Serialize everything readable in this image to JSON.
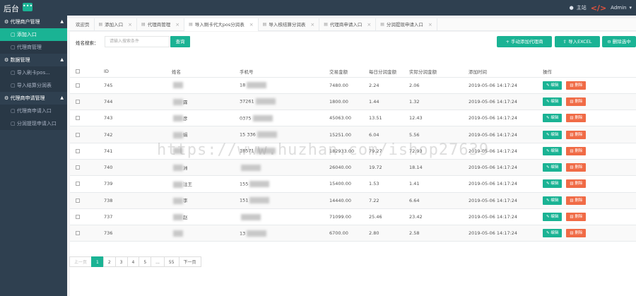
{
  "app": {
    "title": "后台",
    "menu_icon": "menu-dots-icon",
    "home_label": "主站",
    "admin_label": "Admin"
  },
  "sidebar": {
    "groups": [
      {
        "label": "代理商户管理",
        "items": [
          {
            "label": "添加入口",
            "active": true
          },
          {
            "label": "代理商管理",
            "active": false
          }
        ]
      },
      {
        "label": "数据管理",
        "items": [
          {
            "label": "导入刷卡pos...",
            "active": false
          },
          {
            "label": "导入结算分润表",
            "active": false
          }
        ]
      },
      {
        "label": "代理商申请管理",
        "items": [
          {
            "label": "代理商申请入口",
            "active": false
          },
          {
            "label": "分润提现申请入口",
            "active": false
          }
        ]
      }
    ]
  },
  "tabs": [
    {
      "label": "欢迎页",
      "active": false
    },
    {
      "label": "添加入口",
      "active": false
    },
    {
      "label": "代理商管理",
      "active": false
    },
    {
      "label": "导入刷卡代大pos分润表",
      "active": true
    },
    {
      "label": "导入核结算分润表",
      "active": false
    },
    {
      "label": "代理商申请入口",
      "active": false
    },
    {
      "label": "分润提现申请入口",
      "active": false
    }
  ],
  "toolbar": {
    "search_label": "姓名搜索：",
    "search_placeholder": "请输入搜索条件",
    "search_button": "查询",
    "manual_button": "+ 手动添加代理商",
    "import_button": "导入EXCEL",
    "delete_button": "删除选中"
  },
  "table": {
    "headers": [
      "ID",
      "姓名",
      "手机号",
      "交易金额",
      "每日分润金额",
      "实际分润金额",
      "添加时间",
      "操作"
    ],
    "edit_label": "编辑",
    "delete_label": "删除",
    "rows": [
      {
        "id": "745",
        "name": "",
        "phone": "18",
        "amount": "7480.00",
        "daily": "2.24",
        "actual": "2.06",
        "time": "2019-05-06 14:17:24"
      },
      {
        "id": "744",
        "name": "霖",
        "phone": "37261",
        "amount": "1800.00",
        "daily": "1.44",
        "actual": "1.32",
        "time": "2019-05-06 14:17:24"
      },
      {
        "id": "743",
        "name": "彦",
        "phone": "0375",
        "amount": "45063.00",
        "daily": "13.51",
        "actual": "12.43",
        "time": "2019-05-06 14:17:24"
      },
      {
        "id": "742",
        "name": "娟",
        "phone": "15 336",
        "amount": "15251.00",
        "daily": "6.04",
        "actual": "5.56",
        "time": "2019-05-06 14:17:24"
      },
      {
        "id": "741",
        "name": "",
        "phone": "18571",
        "amount": "182933.00",
        "daily": "79.27",
        "actual": "72.93",
        "time": "2019-05-06 14:17:24"
      },
      {
        "id": "740",
        "name": "洲",
        "phone": "",
        "amount": "26040.00",
        "daily": "19.72",
        "actual": "18.14",
        "time": "2019-05-06 14:17:24"
      },
      {
        "id": "739",
        "name": "注王",
        "phone": "155",
        "amount": "15400.00",
        "daily": "1.53",
        "actual": "1.41",
        "time": "2019-05-06 14:17:24"
      },
      {
        "id": "738",
        "name": "李",
        "phone": "151",
        "amount": "14440.00",
        "daily": "7.22",
        "actual": "6.64",
        "time": "2019-05-06 14:17:24"
      },
      {
        "id": "737",
        "name": "赵",
        "phone": "",
        "amount": "71099.00",
        "daily": "25.46",
        "actual": "23.42",
        "time": "2019-05-06 14:17:24"
      },
      {
        "id": "736",
        "name": "",
        "phone": "13",
        "amount": "6700.00",
        "daily": "2.80",
        "actual": "2.58",
        "time": "2019-05-06 14:17:24"
      }
    ]
  },
  "pagination": {
    "prev": "上一页",
    "next": "下一页",
    "pages": [
      "1",
      "2",
      "3",
      "4",
      "5",
      "...",
      "55"
    ],
    "active": "1"
  },
  "watermark": "https://www.huzhan.com/ishop27639",
  "colors": {
    "accent": "#1ab394",
    "sidebar": "#2f4050",
    "danger": "#f06b46"
  }
}
